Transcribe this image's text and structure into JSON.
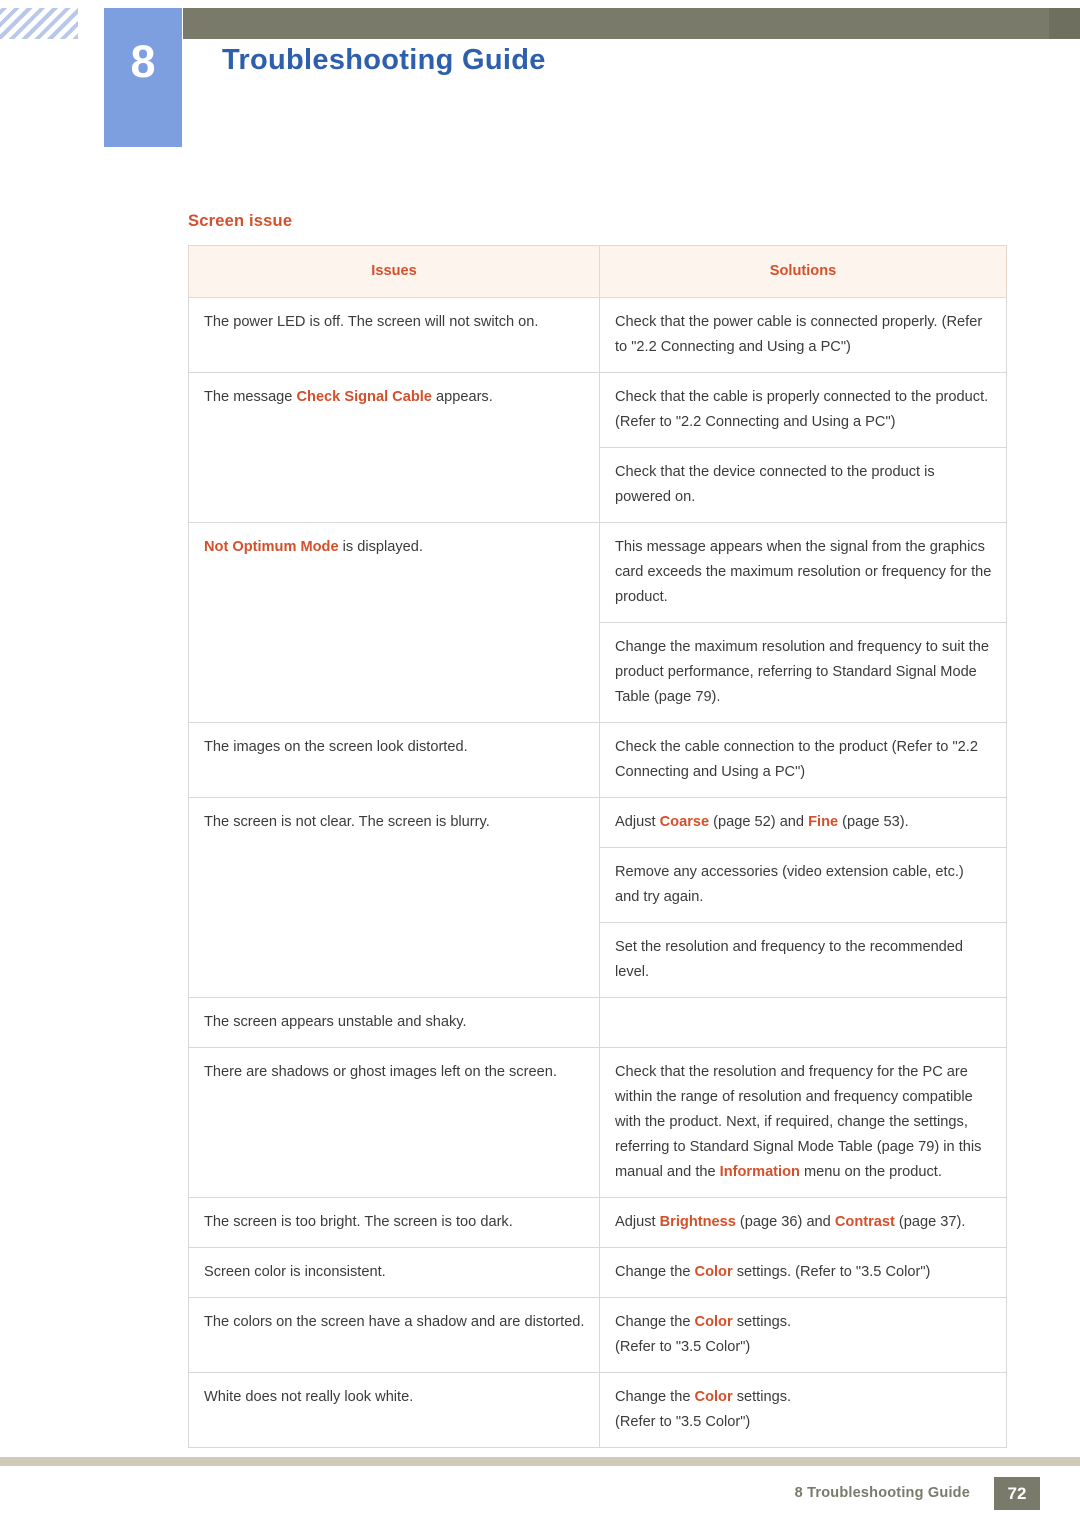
{
  "header": {
    "chapter_number": "8",
    "chapter_title": "Troubleshooting Guide"
  },
  "content": {
    "section_title": "Screen issue",
    "table": {
      "columns": [
        "Issues",
        "Solutions"
      ],
      "rows": [
        {
          "issue_parts": [
            {
              "text": "The power LED is off. The screen will not switch on.",
              "bold": false
            }
          ],
          "solutions": [
            [
              {
                "text": "Check that the power cable is connected properly. (Refer to \"2.2 Connecting and Using a PC\")",
                "bold": false
              }
            ]
          ]
        },
        {
          "issue_parts": [
            {
              "text": "The message ",
              "bold": false
            },
            {
              "text": "Check Signal Cable",
              "bold": true
            },
            {
              "text": " appears.",
              "bold": false
            }
          ],
          "solutions": [
            [
              {
                "text": "Check that the cable is properly connected to the product. (Refer to \"2.2 Connecting and Using a PC\")",
                "bold": false
              }
            ],
            [
              {
                "text": "Check that the device connected to the product is powered on.",
                "bold": false
              }
            ]
          ]
        },
        {
          "issue_parts": [
            {
              "text": "Not Optimum Mode",
              "bold": true
            },
            {
              "text": " is displayed.",
              "bold": false
            }
          ],
          "solutions": [
            [
              {
                "text": "This message appears when the signal from the graphics card exceeds the maximum resolution or frequency for the product.",
                "bold": false
              }
            ],
            [
              {
                "text": "Change the maximum resolution and frequency to suit the product performance, referring to Standard Signal Mode Table (page 79).",
                "bold": false
              }
            ]
          ]
        },
        {
          "issue_parts": [
            {
              "text": "The images on the screen look distorted.",
              "bold": false
            }
          ],
          "solutions": [
            [
              {
                "text": "Check the cable connection to the product (Refer to \"2.2 Connecting and Using a PC\")",
                "bold": false
              }
            ]
          ]
        },
        {
          "issue_parts": [
            {
              "text": "The screen is not clear. The screen is blurry.",
              "bold": false
            }
          ],
          "solutions": [
            [
              {
                "text": "Adjust ",
                "bold": false
              },
              {
                "text": "Coarse",
                "bold": true
              },
              {
                "text": " (page 52) and ",
                "bold": false
              },
              {
                "text": "Fine",
                "bold": true
              },
              {
                "text": " (page 53).",
                "bold": false
              }
            ],
            [
              {
                "text": "Remove any accessories (video extension cable, etc.) and try again.",
                "bold": false
              }
            ],
            [
              {
                "text": "Set the resolution and frequency to the recommended level.",
                "bold": false
              }
            ]
          ]
        },
        {
          "issue_parts": [
            {
              "text": "The screen appears unstable and shaky.",
              "bold": false
            }
          ],
          "solutions": []
        },
        {
          "issue_parts": [
            {
              "text": "There are shadows or ghost images left on the screen.",
              "bold": false
            }
          ],
          "solutions": [
            [
              {
                "text": "Check that the resolution and frequency for the PC are within the range of resolution and frequency compatible with the product. Next, if required, change the settings, referring to Standard Signal Mode Table (page 79) in this manual and the ",
                "bold": false
              },
              {
                "text": "Information",
                "bold": true
              },
              {
                "text": " menu on the product.",
                "bold": false
              }
            ]
          ]
        },
        {
          "issue_parts": [
            {
              "text": "The screen is too bright. The screen is too dark.",
              "bold": false
            }
          ],
          "solutions": [
            [
              {
                "text": "Adjust ",
                "bold": false
              },
              {
                "text": "Brightness",
                "bold": true
              },
              {
                "text": " (page 36) and ",
                "bold": false
              },
              {
                "text": "Contrast",
                "bold": true
              },
              {
                "text": " (page 37).",
                "bold": false
              }
            ]
          ]
        },
        {
          "issue_parts": [
            {
              "text": "Screen color is inconsistent.",
              "bold": false
            }
          ],
          "solutions": [
            [
              {
                "text": "Change the ",
                "bold": false
              },
              {
                "text": "Color",
                "bold": true
              },
              {
                "text": " settings. (Refer to \"3.5 Color\")",
                "bold": false
              }
            ]
          ]
        },
        {
          "issue_parts": [
            {
              "text": "The colors on the screen have a shadow and are distorted.",
              "bold": false
            }
          ],
          "solutions": [
            [
              {
                "text": "Change the ",
                "bold": false
              },
              {
                "text": "Color",
                "bold": true
              },
              {
                "text": " settings.\n(Refer to \"3.5 Color\")",
                "bold": false
              }
            ]
          ]
        },
        {
          "issue_parts": [
            {
              "text": "White does not really look white.",
              "bold": false
            }
          ],
          "solutions": [
            [
              {
                "text": "Change the ",
                "bold": false
              },
              {
                "text": "Color",
                "bold": true
              },
              {
                "text": " settings.\n(Refer to \"3.5 Color\")",
                "bold": false
              }
            ]
          ]
        }
      ]
    }
  },
  "footer": {
    "label": "8 Troubleshooting Guide",
    "page_number": "72"
  },
  "colors": {
    "accent_orange": "#d4502b",
    "chapter_blue": "#7d9fe0",
    "title_blue": "#2e5fad",
    "footer_olive": "#7a7a6b"
  }
}
